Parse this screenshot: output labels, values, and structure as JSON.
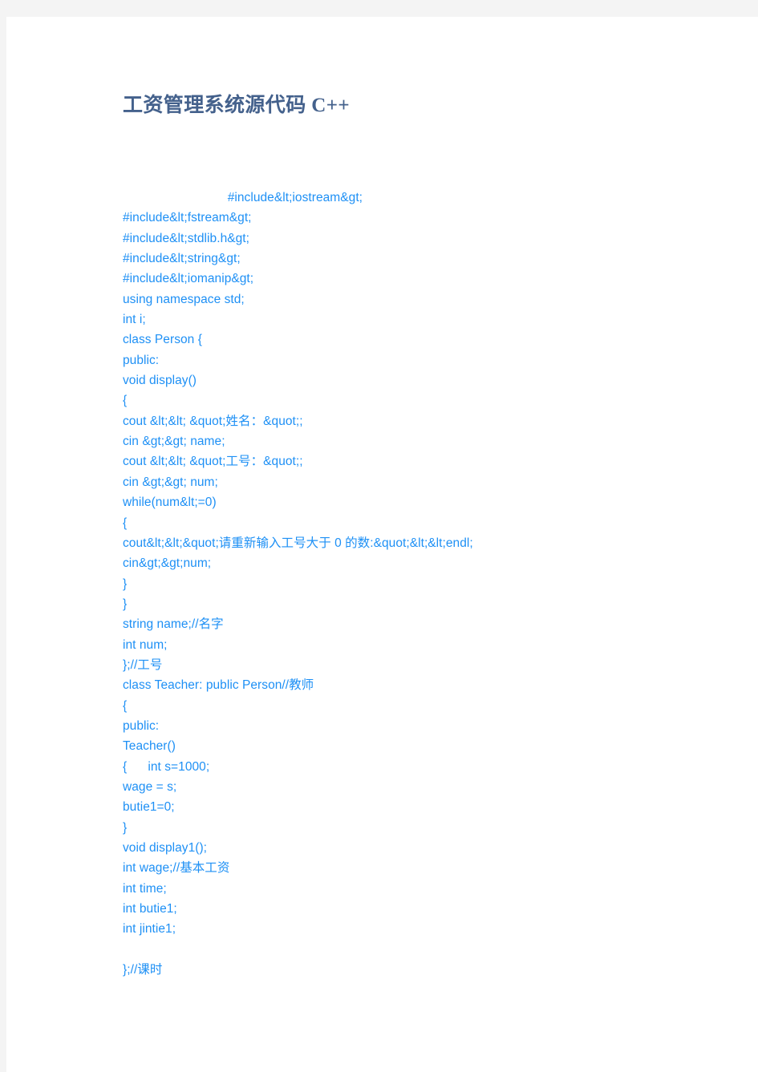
{
  "document": {
    "title": "工资管理系统源代码 C++",
    "colors": {
      "page_background": "#ffffff",
      "canvas_background": "#f4f4f4",
      "title_color": "#44618c",
      "code_color": "#1e90f5"
    }
  },
  "code": {
    "language": "C++",
    "lines": [
      "                              #include&lt;iostream&gt;",
      "#include&lt;fstream&gt;",
      "#include&lt;stdlib.h&gt;",
      "#include&lt;string&gt;",
      "#include&lt;iomanip&gt;",
      "using namespace std;",
      "int i;",
      "class Person {",
      "public:",
      "void display()",
      "{",
      "cout &lt;&lt; &quot;姓名：&quot;;",
      "cin &gt;&gt; name;",
      "cout &lt;&lt; &quot;工号：&quot;;",
      "cin &gt;&gt; num;",
      "while(num&lt;=0)",
      "{",
      "cout&lt;&lt;&quot;请重新输入工号大于 0 的数:&quot;&lt;&lt;endl;",
      "cin&gt;&gt;num;",
      "}",
      "}",
      "string name;//名字",
      "int num;",
      "};//工号",
      "class Teacher: public Person//教师",
      "{",
      "public:",
      "Teacher()",
      "{      int s=1000;",
      "wage = s;",
      "butie1=0;",
      "}",
      "void display1();",
      "int wage;//基本工资",
      "int time;",
      "int butie1;",
      "int jintie1;",
      "",
      "};//课时"
    ]
  }
}
